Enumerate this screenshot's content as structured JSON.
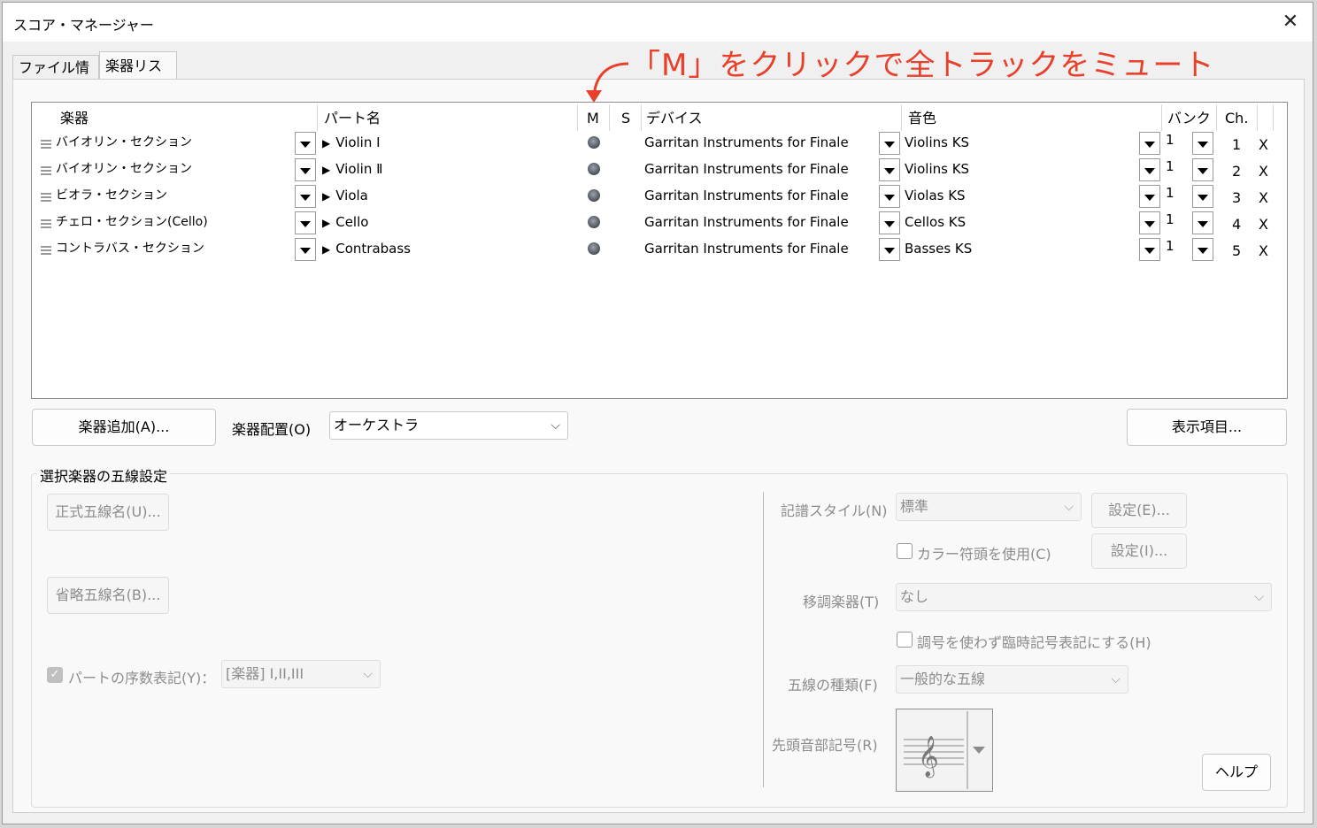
{
  "window": {
    "title": "スコア・マネージャー",
    "close": "✕"
  },
  "tabs": [
    {
      "label": "ファイル情報"
    },
    {
      "label": "楽器リスト"
    }
  ],
  "annotation": "「M」をクリックで全トラックをミュート",
  "columns": {
    "instrument": "楽器",
    "part": "パート名",
    "mute": "M",
    "solo": "S",
    "device": "デバイス",
    "sound": "音色",
    "bank": "バンク",
    "channel": "Ch."
  },
  "rows": [
    {
      "instrument": "バイオリン・セクション",
      "part": "Violin Ⅰ",
      "device": "Garritan Instruments for Finale",
      "sound": "Violins KS",
      "bank": "1",
      "ch": "1",
      "del": "X"
    },
    {
      "instrument": "バイオリン・セクション",
      "part": "Violin Ⅱ",
      "device": "Garritan Instruments for Finale",
      "sound": "Violins KS",
      "bank": "1",
      "ch": "2",
      "del": "X"
    },
    {
      "instrument": "ビオラ・セクション",
      "part": "Viola",
      "device": "Garritan Instruments for Finale",
      "sound": "Violas KS",
      "bank": "1",
      "ch": "3",
      "del": "X"
    },
    {
      "instrument": "チェロ・セクション(Cello)",
      "part": "Cello",
      "device": "Garritan Instruments for Finale",
      "sound": "Cellos KS",
      "bank": "1",
      "ch": "4",
      "del": "X"
    },
    {
      "instrument": "コントラバス・セクション",
      "part": "Contrabass",
      "device": "Garritan Instruments for Finale",
      "sound": "Basses KS",
      "bank": "1",
      "ch": "5",
      "del": "X"
    }
  ],
  "controls": {
    "add_instrument": "楽器追加(A)...",
    "arrangement_label": "楽器配置(O)",
    "arrangement_value": "オーケストラ",
    "display_items": "表示項目..."
  },
  "staff_settings": {
    "group_title": "選択楽器の五線設定",
    "full_name_button": "正式五線名(U)...",
    "abbr_name_button": "省略五線名(B)...",
    "part_ordinal_label": "パートの序数表記(Y)：",
    "part_ordinal_value": "[楽器] I,II,III",
    "notation_style_label": "記譜スタイル(N)",
    "notation_style_value": "標準",
    "settings_e": "設定(E)...",
    "color_noteheads": "カラー符頭を使用(C)",
    "settings_i": "設定(I)...",
    "transposition_label": "移調楽器(T)",
    "transposition_value": "なし",
    "accidentals_check": "調号を使わず臨時記号表記にする(H)",
    "staff_type_label": "五線の種類(F)",
    "staff_type_value": "一般的な五線",
    "first_clef_label": "先頭音部記号(R)",
    "help_button": "ヘルプ"
  },
  "colors": {
    "annotation": "#e8402a"
  }
}
